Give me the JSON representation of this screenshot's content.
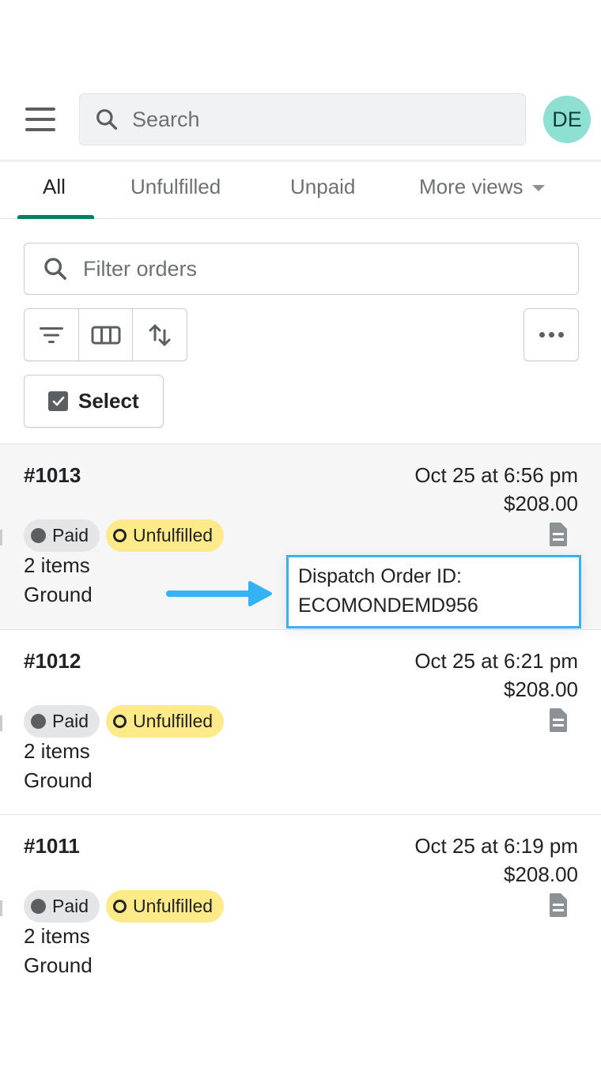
{
  "header": {
    "menu_icon": "hamburger-menu-icon",
    "search_placeholder": "Search",
    "avatar_initials": "DE",
    "avatar_color": "#8de0d2"
  },
  "tabs": [
    {
      "label": "All",
      "active": true
    },
    {
      "label": "Unfulfilled",
      "active": false
    },
    {
      "label": "Unpaid",
      "active": false
    },
    {
      "label": "More views",
      "active": false,
      "has_dropdown": true
    }
  ],
  "accent_color": "#008060",
  "toolbar": {
    "filter_placeholder": "Filter orders",
    "filter_icon": "filter-icon",
    "columns_icon": "columns-icon",
    "sort_icon": "sort-icon",
    "more_icon": "more-horizontal-icon",
    "select_label": "Select"
  },
  "orders": [
    {
      "number": "#1013",
      "date": "Oct 25 at 6:56 pm",
      "total": "$208.00",
      "payment_status": "Paid",
      "fulfillment_status": "Unfulfilled",
      "items": "2 items",
      "shipping": "Ground",
      "highlighted": true
    },
    {
      "number": "#1012",
      "date": "Oct 25 at 6:21 pm",
      "total": "$208.00",
      "payment_status": "Paid",
      "fulfillment_status": "Unfulfilled",
      "items": "2 items",
      "shipping": "Ground",
      "highlighted": false
    },
    {
      "number": "#1011",
      "date": "Oct 25 at 6:19 pm",
      "total": "$208.00",
      "payment_status": "Paid",
      "fulfillment_status": "Unfulfilled",
      "items": "2 items",
      "shipping": "Ground",
      "highlighted": false
    }
  ],
  "annotation": {
    "line1": "Dispatch Order ID:",
    "line2": "ECOMONDEMD956",
    "border_color": "#35b2f4"
  }
}
